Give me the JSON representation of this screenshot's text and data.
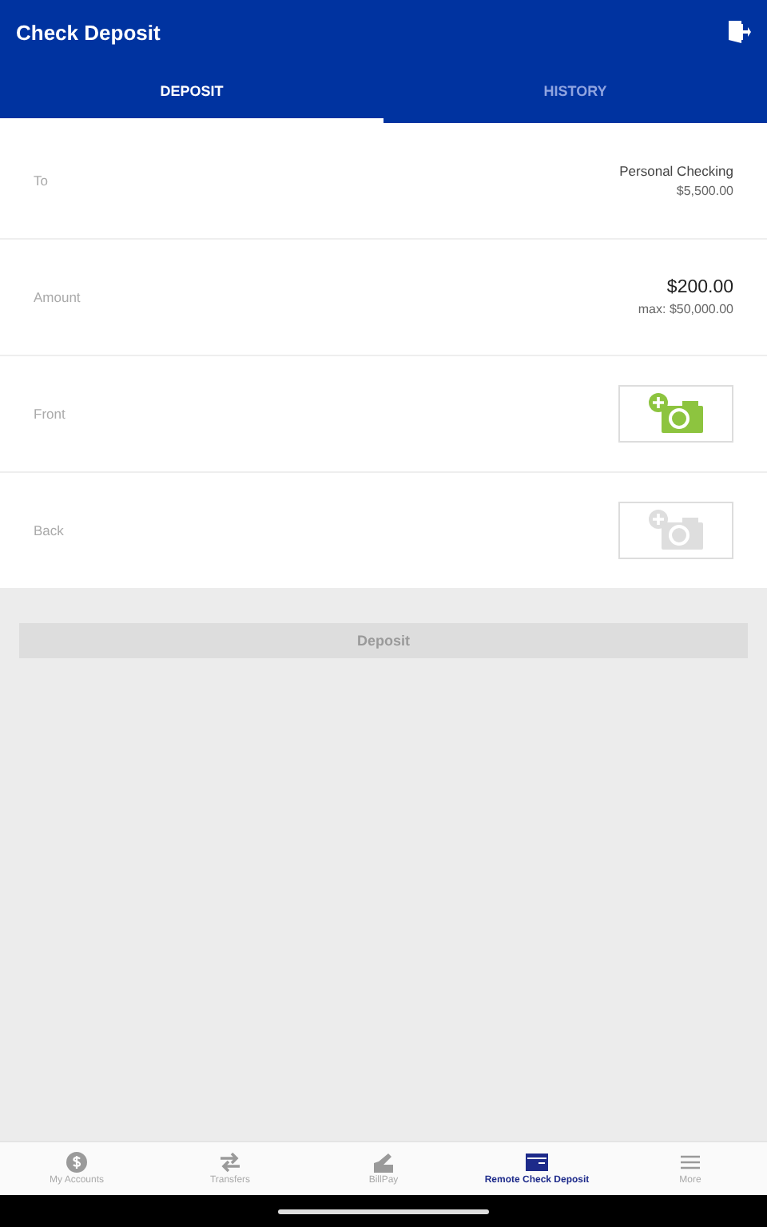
{
  "app_bar": {
    "title": "Check Deposit"
  },
  "tabs": [
    {
      "label": "DEPOSIT",
      "selected": true
    },
    {
      "label": "HISTORY",
      "selected": false
    }
  ],
  "form_rows": [
    {
      "kind": "text",
      "label": "To",
      "value": "Personal Checking",
      "detail": "$5,500.00"
    },
    {
      "kind": "amount",
      "label": "Amount",
      "value": "$200.00",
      "detail": "max: $50,000.00"
    },
    {
      "kind": "photo",
      "label": "Front",
      "disabled": false
    },
    {
      "kind": "photo",
      "label": "Back",
      "disabled": true
    }
  ],
  "deposit_button": {
    "label": "Deposit",
    "disabled": true
  },
  "bottom_nav": [
    {
      "kind": "accounts",
      "label": "My Accounts",
      "selected": false
    },
    {
      "kind": "transfers",
      "label": "Transfers",
      "selected": false
    },
    {
      "kind": "billpay",
      "label": "BillPay",
      "selected": false
    },
    {
      "kind": "deposit",
      "label": "Remote Check Deposit",
      "selected": true
    },
    {
      "kind": "more",
      "label": "More",
      "selected": false
    }
  ]
}
